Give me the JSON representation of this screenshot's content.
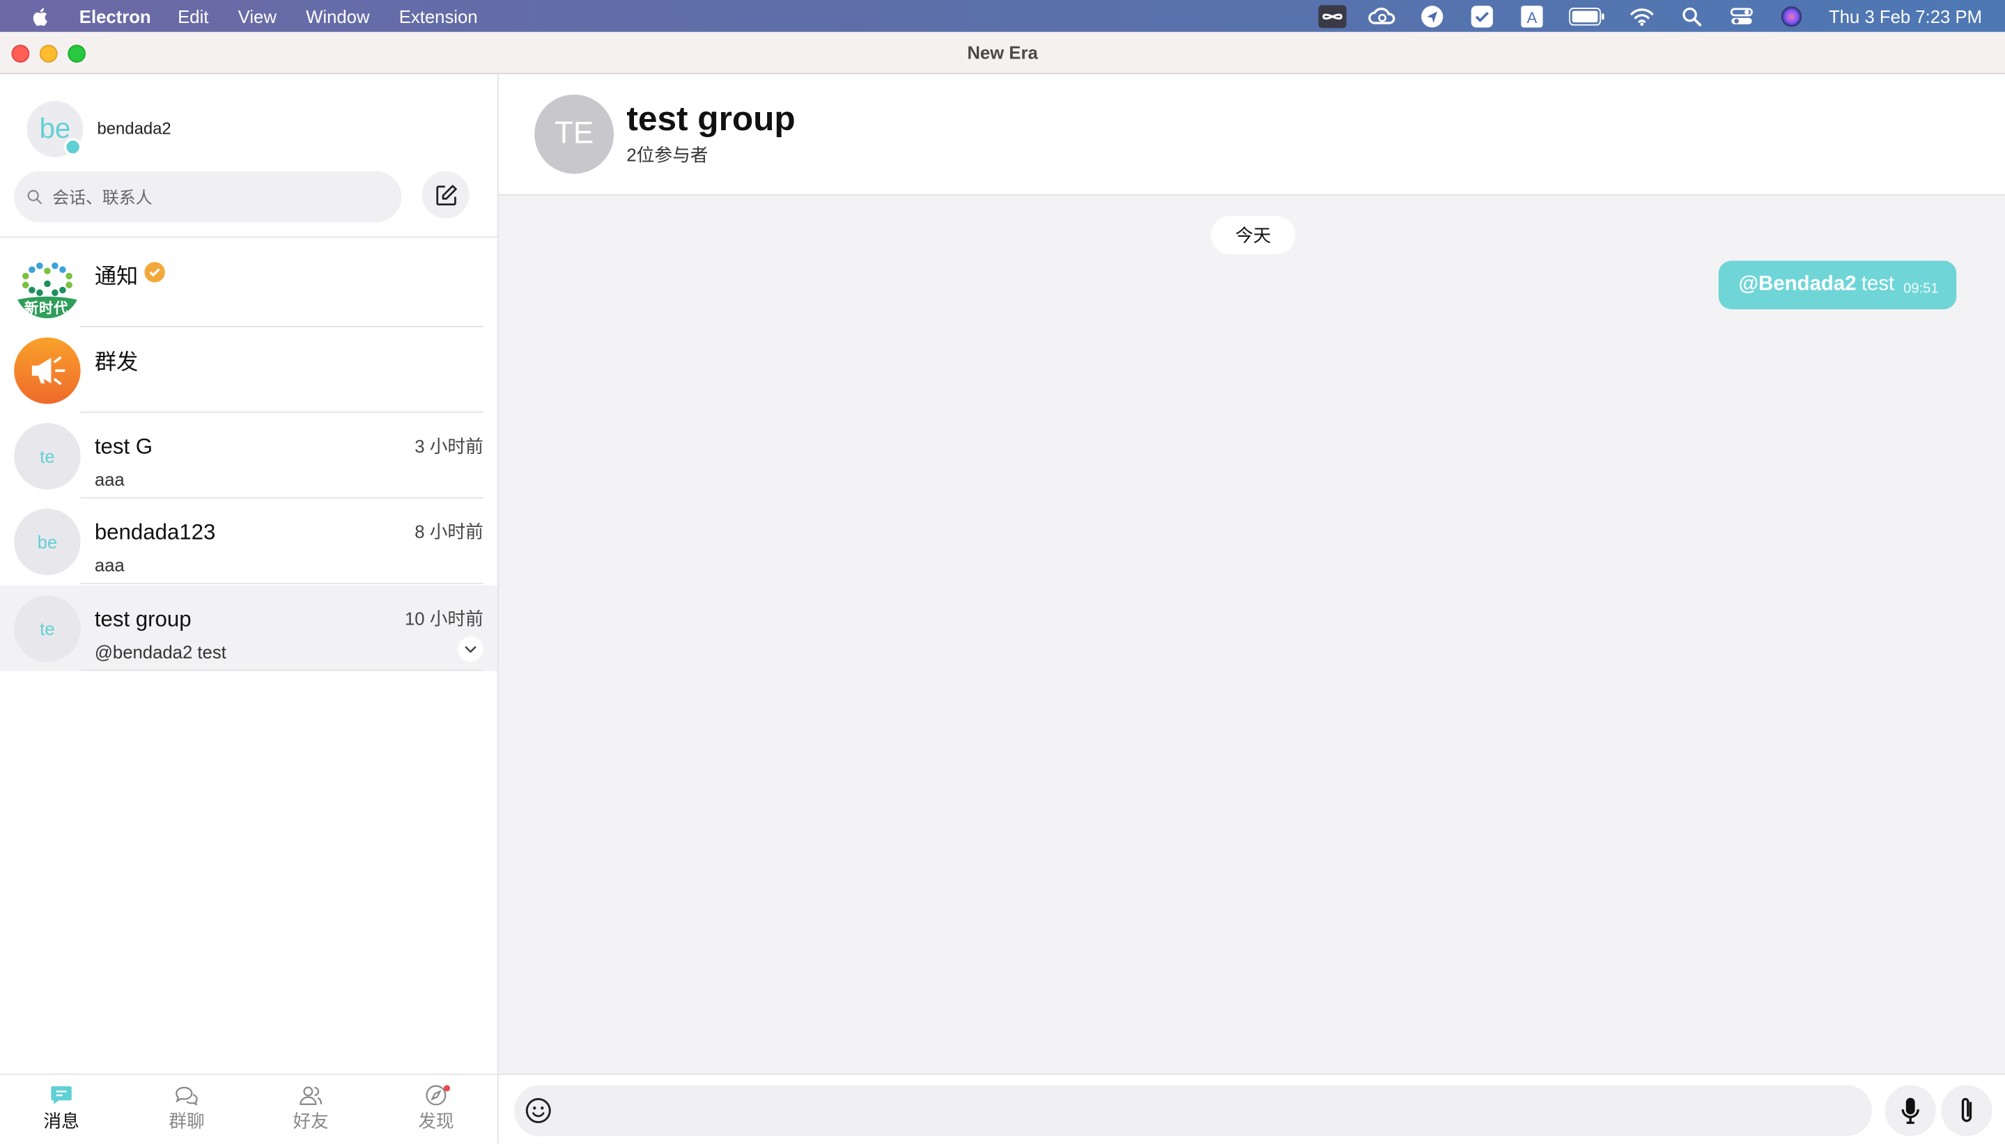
{
  "menubar": {
    "app_name": "Electron",
    "items": [
      "Edit",
      "View",
      "Window",
      "Extension"
    ],
    "clock": "Thu 3 Feb  7:23 PM"
  },
  "window": {
    "title": "New Era"
  },
  "sidebar": {
    "me": {
      "avatar_text": "be",
      "name": "bendada2"
    },
    "search_placeholder": "会话、联系人",
    "conversations": [
      {
        "name": "通知",
        "verified": true,
        "avatar_caption": "新时代"
      },
      {
        "name": "群发"
      },
      {
        "avatar_text": "te",
        "name": "test G",
        "time": "3 小时前",
        "preview": "aaa"
      },
      {
        "avatar_text": "be",
        "name": "bendada123",
        "time": "8 小时前",
        "preview": "aaa"
      },
      {
        "avatar_text": "te",
        "name": "test group",
        "time": "10 小时前",
        "preview": "@bendada2 test",
        "selected": true
      }
    ],
    "tabs": [
      {
        "label": "消息",
        "active": true
      },
      {
        "label": "群聊"
      },
      {
        "label": "好友"
      },
      {
        "label": "发现",
        "badge_dot": true
      }
    ]
  },
  "chat": {
    "avatar_text": "TE",
    "title": "test group",
    "subtitle": "2位参与者",
    "date_separator": "今天",
    "messages": [
      {
        "mention": "@Bendada2",
        "text": "test",
        "time": "09:51",
        "outgoing": true
      }
    ]
  },
  "colors": {
    "accent": "#6fd5d7",
    "menubar": "#5e6ea8",
    "verified": "#f2a93b",
    "notify_badge": "#e84b4b"
  }
}
